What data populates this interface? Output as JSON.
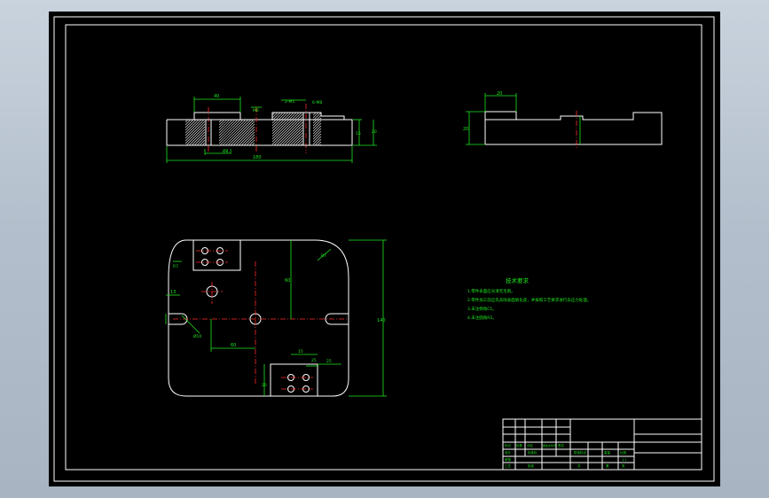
{
  "colors": {
    "background": "#000000",
    "frame": "#ffffff",
    "dimension": "#1ee81e",
    "centerline": "#ff2a2a",
    "app_chrome": "#b8c3cf"
  },
  "dimensions": {
    "front_view": {
      "top_width": "40",
      "slot": "2-M5",
      "small_top": "6-M8",
      "hole_label": "M6",
      "depth": "Ø8.5",
      "overall_length": "180",
      "height_small": "15",
      "height_total": "20"
    },
    "side_view": {
      "top_width": "20",
      "height": "20"
    },
    "plan_view": {
      "radius": "R7",
      "offset_left": "13",
      "vertical_center": "60",
      "horizontal_center": "60",
      "hole_diameter": "Ø10",
      "overall_height": "140",
      "block_width": "25",
      "block_spacing": "15",
      "block_height": "20",
      "right_offset": "25"
    }
  },
  "notes": {
    "title": "技术要求",
    "lines": [
      "1.零件表面应光滑无毛刺。",
      "2.零件加工前应先去除表面氧化皮，并按照工艺要求进行去应力处理。",
      "3.未注倒角C1。",
      "4.未注圆角R2。"
    ]
  },
  "title_block": {
    "labels": {
      "design": "设计",
      "standard": "标准化",
      "review": "审核",
      "process": "工艺",
      "stage_mark": "阶段标记",
      "weight": "重量",
      "scale": "比例",
      "scale_value": "1:1",
      "sheet_total": "共",
      "sheet_index": "第",
      "page": "张",
      "approve": "批准",
      "date": "日期",
      "mark": "标记",
      "count": "处数",
      "zone": "分区",
      "change_doc": "更改文件号",
      "signature": "签名"
    }
  }
}
